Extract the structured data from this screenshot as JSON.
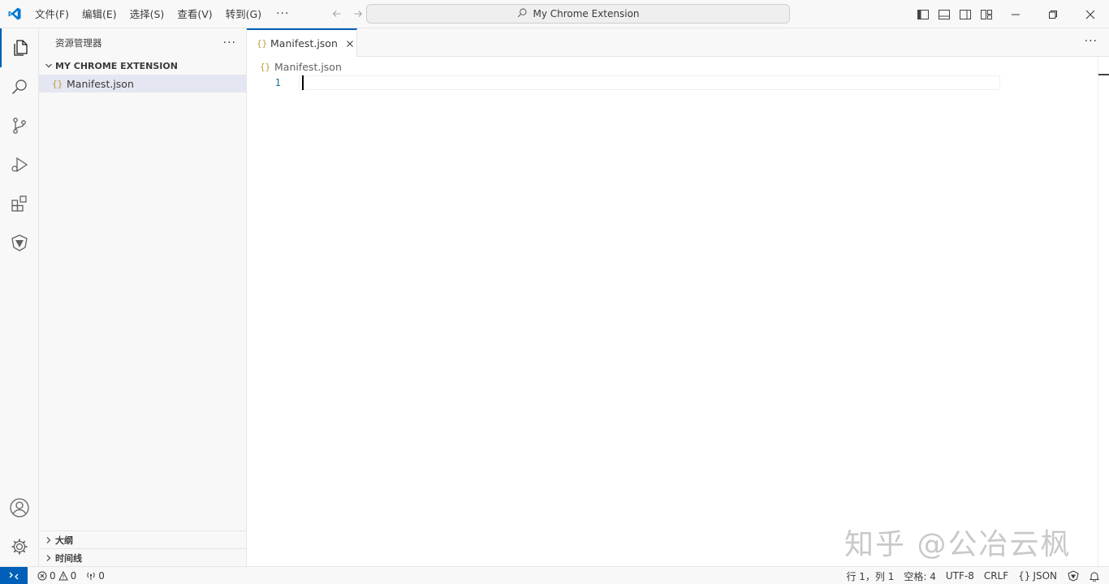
{
  "menu": {
    "items": [
      "文件(F)",
      "编辑(E)",
      "选择(S)",
      "查看(V)",
      "转到(G)"
    ],
    "more": "···"
  },
  "command_center": {
    "text": "My Chrome Extension",
    "icon": "search-icon"
  },
  "sidebar": {
    "title": "资源管理器",
    "more": "···",
    "folder": "MY CHROME EXTENSION",
    "files": [
      {
        "icon_text": "{}",
        "name": "Manifest.json"
      }
    ],
    "outline": "大纲",
    "timeline": "时间线"
  },
  "editor": {
    "tab_icon": "{}",
    "tab_label": "Manifest.json",
    "more": "···",
    "breadcrumb_icon": "{}",
    "breadcrumb": "Manifest.json",
    "line_number": "1"
  },
  "watermark": "知乎 @公冶云枫",
  "status": {
    "errors": "0",
    "warnings": "0",
    "ports": "0",
    "position": "行 1，列 1",
    "spaces": "空格: 4",
    "encoding": "UTF-8",
    "eol": "CRLF",
    "lang_icon": "{}",
    "language": "JSON"
  },
  "colors": {
    "accent": "#005fb8",
    "json_icon": "#b8a037",
    "line_number": "#237893"
  }
}
